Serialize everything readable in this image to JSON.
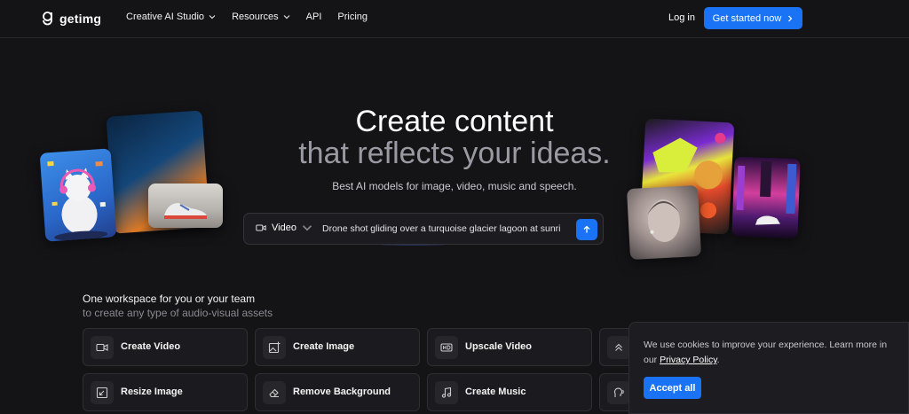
{
  "brand": {
    "name": "getimg"
  },
  "nav": {
    "links": [
      {
        "label": "Creative AI Studio"
      },
      {
        "label": "Resources"
      },
      {
        "label": "API"
      },
      {
        "label": "Pricing"
      }
    ],
    "login_label": "Log in",
    "cta_label": "Get started now"
  },
  "hero": {
    "title_line1": "Create content",
    "title_line2": "that reflects your ideas.",
    "subtitle": "Best AI models for image, video, music and speech."
  },
  "prompt": {
    "mode_label": "Video",
    "value": "Drone shot gliding over a turquoise glacier lagoon at sunri"
  },
  "workspace": {
    "title": "One workspace for you or your team",
    "subtitle": "to create any type of audio-visual assets",
    "cards": [
      {
        "label": "Create Video",
        "icon": "video-icon"
      },
      {
        "label": "Create Image",
        "icon": "image-plus-icon"
      },
      {
        "label": "Upscale Video",
        "icon": "hd-icon"
      },
      {
        "label": "",
        "icon": "upscale-icon"
      },
      {
        "label": "Resize Image",
        "icon": "resize-icon"
      },
      {
        "label": "Remove Background",
        "icon": "eraser-icon"
      },
      {
        "label": "Create Music",
        "icon": "music-note-icon"
      },
      {
        "label": "",
        "icon": "speech-icon"
      }
    ]
  },
  "cookie": {
    "text": "We use cookies to improve your experience. Learn more in our ",
    "link_label": "Privacy Policy",
    "suffix": ".",
    "accept_label": "Accept all"
  },
  "colors": {
    "background": "#141417",
    "accent": "#1a73f5",
    "muted_title": "#9a9ba2"
  }
}
